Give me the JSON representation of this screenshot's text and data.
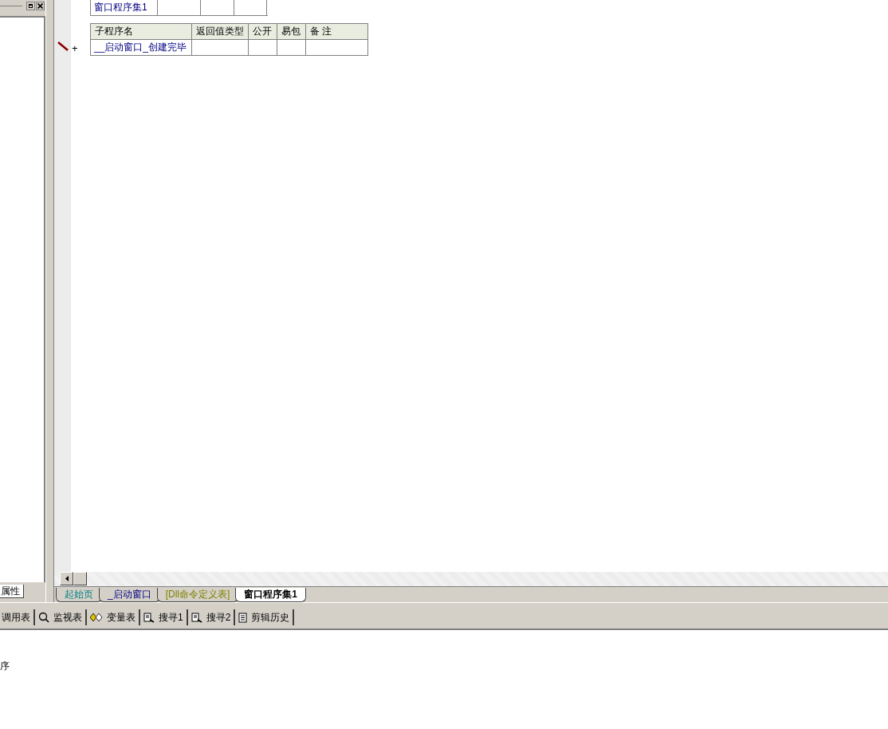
{
  "left_panel": {
    "tab": "属性"
  },
  "editor": {
    "assembly_table": {
      "name": "窗口程序集1"
    },
    "sub_table": {
      "columns": [
        "子程序名",
        "返回值类型",
        "公开",
        "易包",
        "备 注"
      ],
      "rows": [
        {
          "name": "__启动窗口_创建完毕"
        }
      ]
    },
    "row_marker": "+"
  },
  "tabs": [
    {
      "label": "起始页",
      "selected": false,
      "kind": "start"
    },
    {
      "label": "_启动窗口",
      "selected": false,
      "kind": "window"
    },
    {
      "label": "[Dll命令定义表]",
      "selected": false,
      "kind": "dll"
    },
    {
      "label": "窗口程序集1",
      "selected": true,
      "kind": "assembly"
    }
  ],
  "toolbar": [
    {
      "label": "调用表",
      "kind": "none"
    },
    {
      "label": "监视表",
      "kind": "magnifier"
    },
    {
      "label": "变量表",
      "kind": "diamonds"
    },
    {
      "label": "搜寻1",
      "kind": "search-doc"
    },
    {
      "label": "搜寻2",
      "kind": "search-doc"
    },
    {
      "label": "剪辑历史",
      "kind": "document"
    }
  ],
  "output": {
    "line": "序"
  }
}
